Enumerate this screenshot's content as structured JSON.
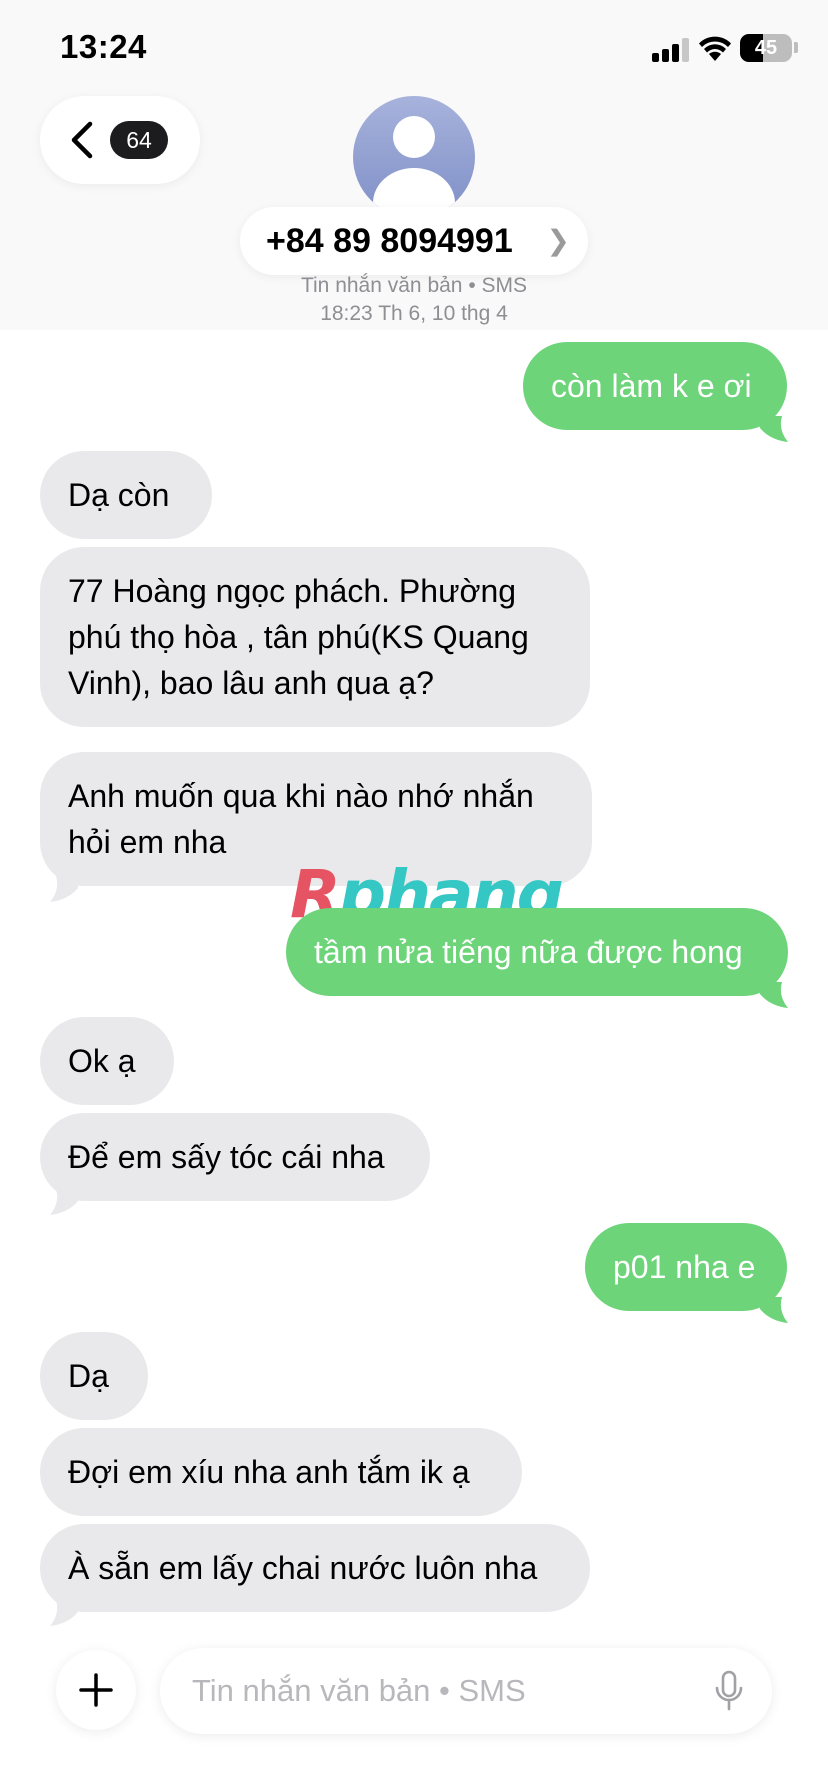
{
  "status_bar": {
    "time": "13:24",
    "battery": "45",
    "icons": [
      "signal-icon",
      "wifi-icon",
      "battery-icon"
    ]
  },
  "header": {
    "back_badge": "64",
    "contact": "+84 89 8094991",
    "service": "Tin nhắn văn bản • SMS",
    "timestamp": "18:23 Th 6, 10 thg 4",
    "icons": [
      "chevron-left-icon",
      "avatar-icon",
      "chevron-right-icon"
    ]
  },
  "messages": [
    {
      "direction": "out",
      "text": "còn làm k e ơi"
    },
    {
      "direction": "in",
      "text": "Dạ còn"
    },
    {
      "direction": "in",
      "text": "77 Hoàng ngọc phách. Phường phú thọ hòa , tân phú(KS Quang Vinh), bao lâu anh qua ạ?"
    },
    {
      "direction": "in",
      "text": "Anh muốn qua khi nào nhớ nhắn hỏi em nha"
    },
    {
      "direction": "out",
      "text": "tầm nửa tiếng nữa được hong"
    },
    {
      "direction": "in",
      "text": "Ok ạ"
    },
    {
      "direction": "in",
      "text": "Để em sấy tóc cái nha"
    },
    {
      "direction": "out",
      "text": "p01 nha e"
    },
    {
      "direction": "in",
      "text": "Dạ"
    },
    {
      "direction": "in",
      "text": "Đợi em xíu nha anh tắm ik ạ"
    },
    {
      "direction": "in",
      "text": "À sẵn em lấy chai nước luôn nha"
    }
  ],
  "watermark": {
    "first": "R",
    "rest": "phang"
  },
  "composer": {
    "placeholder": "Tin nhắn văn bản • SMS",
    "icons": [
      "plus-icon",
      "microphone-icon"
    ]
  },
  "colors": {
    "outgoing_bubble": "#6dd47a",
    "incoming_bubble": "#e9e9eb",
    "badge": "#1c1c1e"
  }
}
